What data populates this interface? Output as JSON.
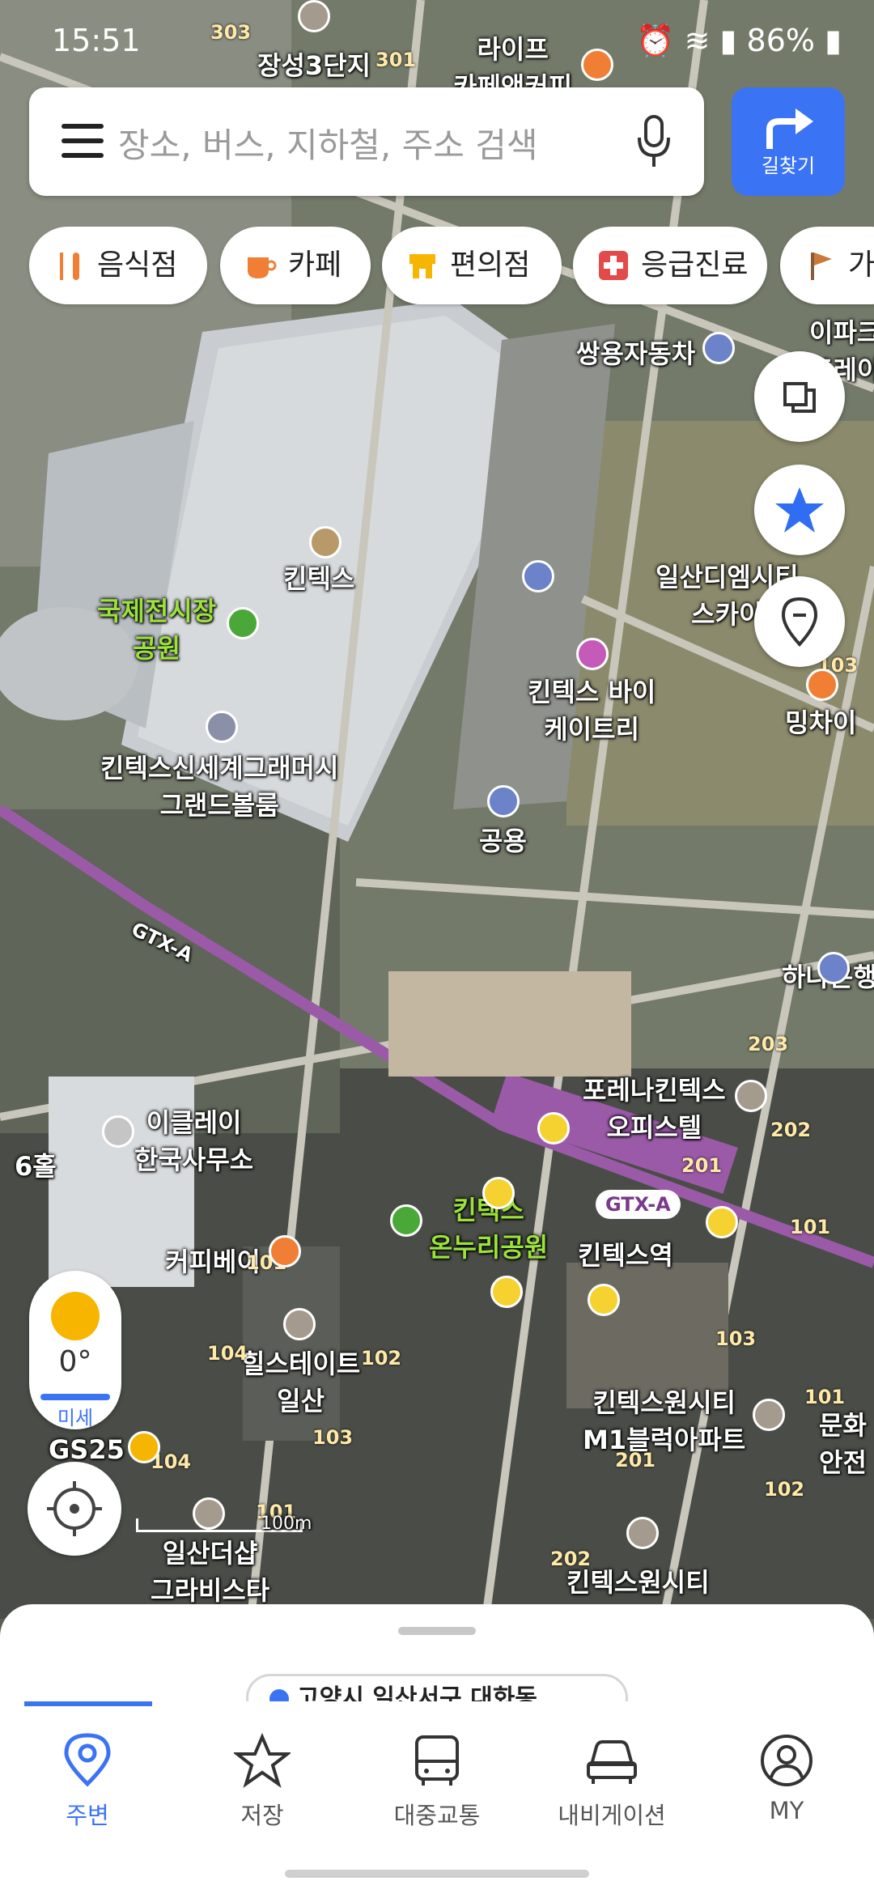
{
  "status": {
    "time": "15:51",
    "battery": "86%"
  },
  "search": {
    "placeholder": "장소, 버스, 지하철, 주소 검색"
  },
  "route_button": {
    "label": "길찾기"
  },
  "chips": [
    {
      "label": "음식점",
      "icon": "fork-knife-icon"
    },
    {
      "label": "카페",
      "icon": "coffee-cup-icon"
    },
    {
      "label": "편의점",
      "icon": "store-icon"
    },
    {
      "label": "응급진료",
      "icon": "medical-cross-icon"
    },
    {
      "label": "가",
      "icon": "flag-icon"
    }
  ],
  "map": {
    "labels": {
      "kintex": "킨텍스",
      "park": "국제전시장\n공원",
      "grandball": "킨텍스신세계그래머시\n그랜드볼룸",
      "kbuy": "킨텍스 바이\n케이트리",
      "public": "공용",
      "ssangyong": "쌍용자동차",
      "ilsan_dm": "일산디엠시티\n스카이",
      "mingchai": "밍차이",
      "ipark": "이파크\n포레이",
      "forena": "포레나킨텍스\n오피스텔",
      "hana": "하나은행",
      "icley": "이클레이\n한국사무소",
      "hall6": "6홀",
      "coffeebay": "커피베이",
      "onnuri": "킨텍스\n온누리공원",
      "station": "킨텍스역",
      "gtxa": "GTX-A",
      "gtxa_line": "GTX-A",
      "hillstate": "힐스테이트\n일산",
      "gs25": "GS25",
      "grabista": "일산더샵\n그라비스타",
      "onecity_m1": "킨텍스원시티\nM1블럭아파트",
      "onecity2": "킨텍스원시티",
      "munhwa": "문화\n안전",
      "life_cafe": "라이프\n카페앤커피",
      "jangsung": "장성3단지",
      "scale": "100m"
    },
    "numbers": [
      "303",
      "301",
      "103",
      "203",
      "202",
      "201",
      "101",
      "103",
      "102",
      "101",
      "104",
      "102",
      "103",
      "104",
      "101",
      "101",
      "201",
      "202"
    ]
  },
  "weather": {
    "temp": "0°",
    "dust": "미세"
  },
  "sheet": {
    "location": "고양시 일산서구 대화동"
  },
  "nav": [
    {
      "label": "주변",
      "icon": "location-pin-icon"
    },
    {
      "label": "저장",
      "icon": "star-icon"
    },
    {
      "label": "대중교통",
      "icon": "bus-icon"
    },
    {
      "label": "내비게이션",
      "icon": "car-icon"
    },
    {
      "label": "MY",
      "icon": "user-icon"
    }
  ],
  "colors": {
    "accent": "#3b73f5",
    "gtx_line": "#9b5aa8",
    "park_label": "#9be23c"
  }
}
